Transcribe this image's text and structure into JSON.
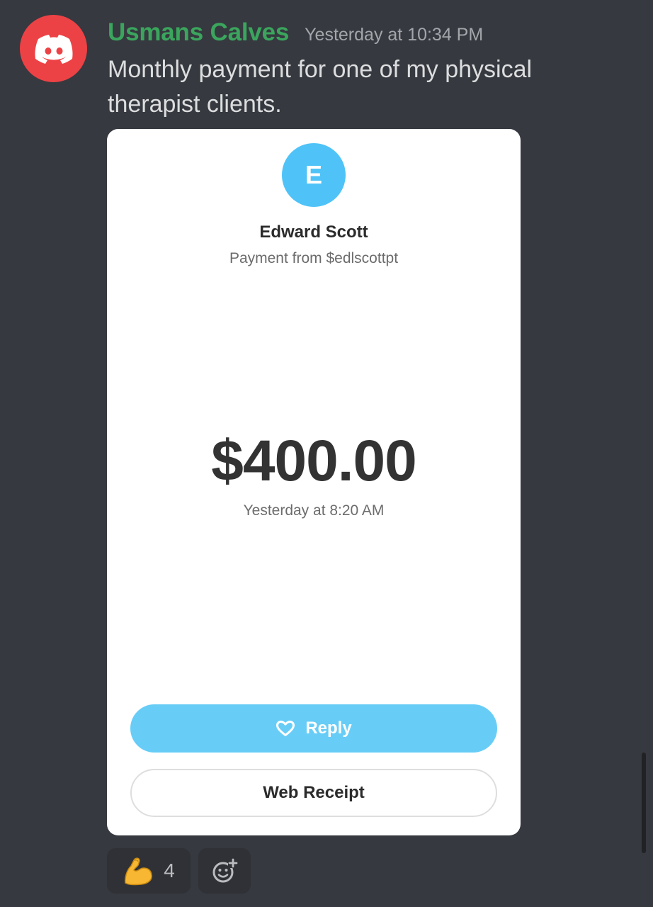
{
  "message": {
    "author": "Usmans Calves",
    "timestamp": "Yesterday at 10:34 PM",
    "text": "Monthly payment for one of my physical therapist clients.",
    "author_color": "#3ba55d",
    "avatar_icon": "discord-logo-icon",
    "avatar_color": "#ed4245"
  },
  "payment_card": {
    "avatar_initial": "E",
    "avatar_color": "#4fc3f7",
    "name": "Edward Scott",
    "subtitle": "Payment from $edlscottpt",
    "amount": "$400.00",
    "time": "Yesterday at 8:20 AM",
    "reply_label": "Reply",
    "reply_icon": "heart-outline-icon",
    "reply_color": "#67cdf7",
    "receipt_label": "Web Receipt"
  },
  "reactions": [
    {
      "emoji": "💪",
      "icon": "flexed-biceps-icon",
      "count": "4"
    }
  ],
  "add_reaction_icon": "add-reaction-icon"
}
